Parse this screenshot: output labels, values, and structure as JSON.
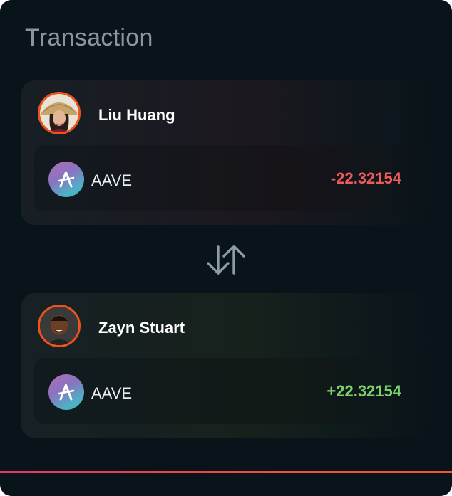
{
  "header": {
    "title": "Transaction"
  },
  "sender": {
    "name": "Liu Huang",
    "token": {
      "symbol": "AAVE",
      "icon": "aave-icon"
    },
    "amount": "-22.32154",
    "amount_color": "#f05a5a"
  },
  "receiver": {
    "name": "Zayn Stuart",
    "token": {
      "symbol": "AAVE",
      "icon": "aave-icon"
    },
    "amount": "+22.32154",
    "amount_color": "#7cd16e"
  },
  "swap_icon": "swap-arrows-icon",
  "colors": {
    "background": "#081419",
    "avatar_ring": "#f0521d",
    "accent_line_start": "#e8326a",
    "accent_line_end": "#f5572a"
  }
}
